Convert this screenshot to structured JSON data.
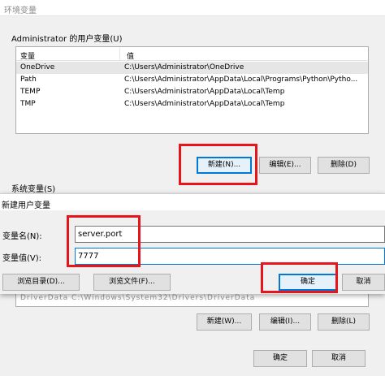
{
  "env_window": {
    "title": "环境变量",
    "user_vars": {
      "group_label": "Administrator 的用户变量(U)",
      "columns": [
        "变量",
        "值"
      ],
      "rows": [
        {
          "name": "OneDrive",
          "value": "C:\\Users\\Administrator\\OneDrive"
        },
        {
          "name": "Path",
          "value": "C:\\Users\\Administrator\\AppData\\Local\\Programs\\Python\\Pytho..."
        },
        {
          "name": "TEMP",
          "value": "C:\\Users\\Administrator\\AppData\\Local\\Temp"
        },
        {
          "name": "TMP",
          "value": "C:\\Users\\Administrator\\AppData\\Local\\Temp"
        }
      ],
      "buttons": {
        "new": "新建(N)...",
        "edit": "编辑(E)...",
        "delete": "删除(D)"
      }
    },
    "system_vars": {
      "group_label": "系统变量(S)",
      "remnant_text": "DriverData    C:\\Windows\\System32\\Drivers\\DriverData",
      "buttons": {
        "new": "新建(W)...",
        "edit": "编辑(I)...",
        "delete": "删除(L)"
      }
    },
    "footer": {
      "ok": "确定",
      "cancel": "取消"
    }
  },
  "dialog": {
    "title": "新建用户变量",
    "name_label": "变量名(N):",
    "name_value": "server.port",
    "value_label": "变量值(V):",
    "value_value": "7777",
    "buttons": {
      "browse_dir": "浏览目录(D)...",
      "browse_file": "浏览文件(F)...",
      "ok": "确定",
      "cancel": "取消"
    }
  },
  "highlight_color": "#e8141b",
  "accent_color": "#0078d7"
}
